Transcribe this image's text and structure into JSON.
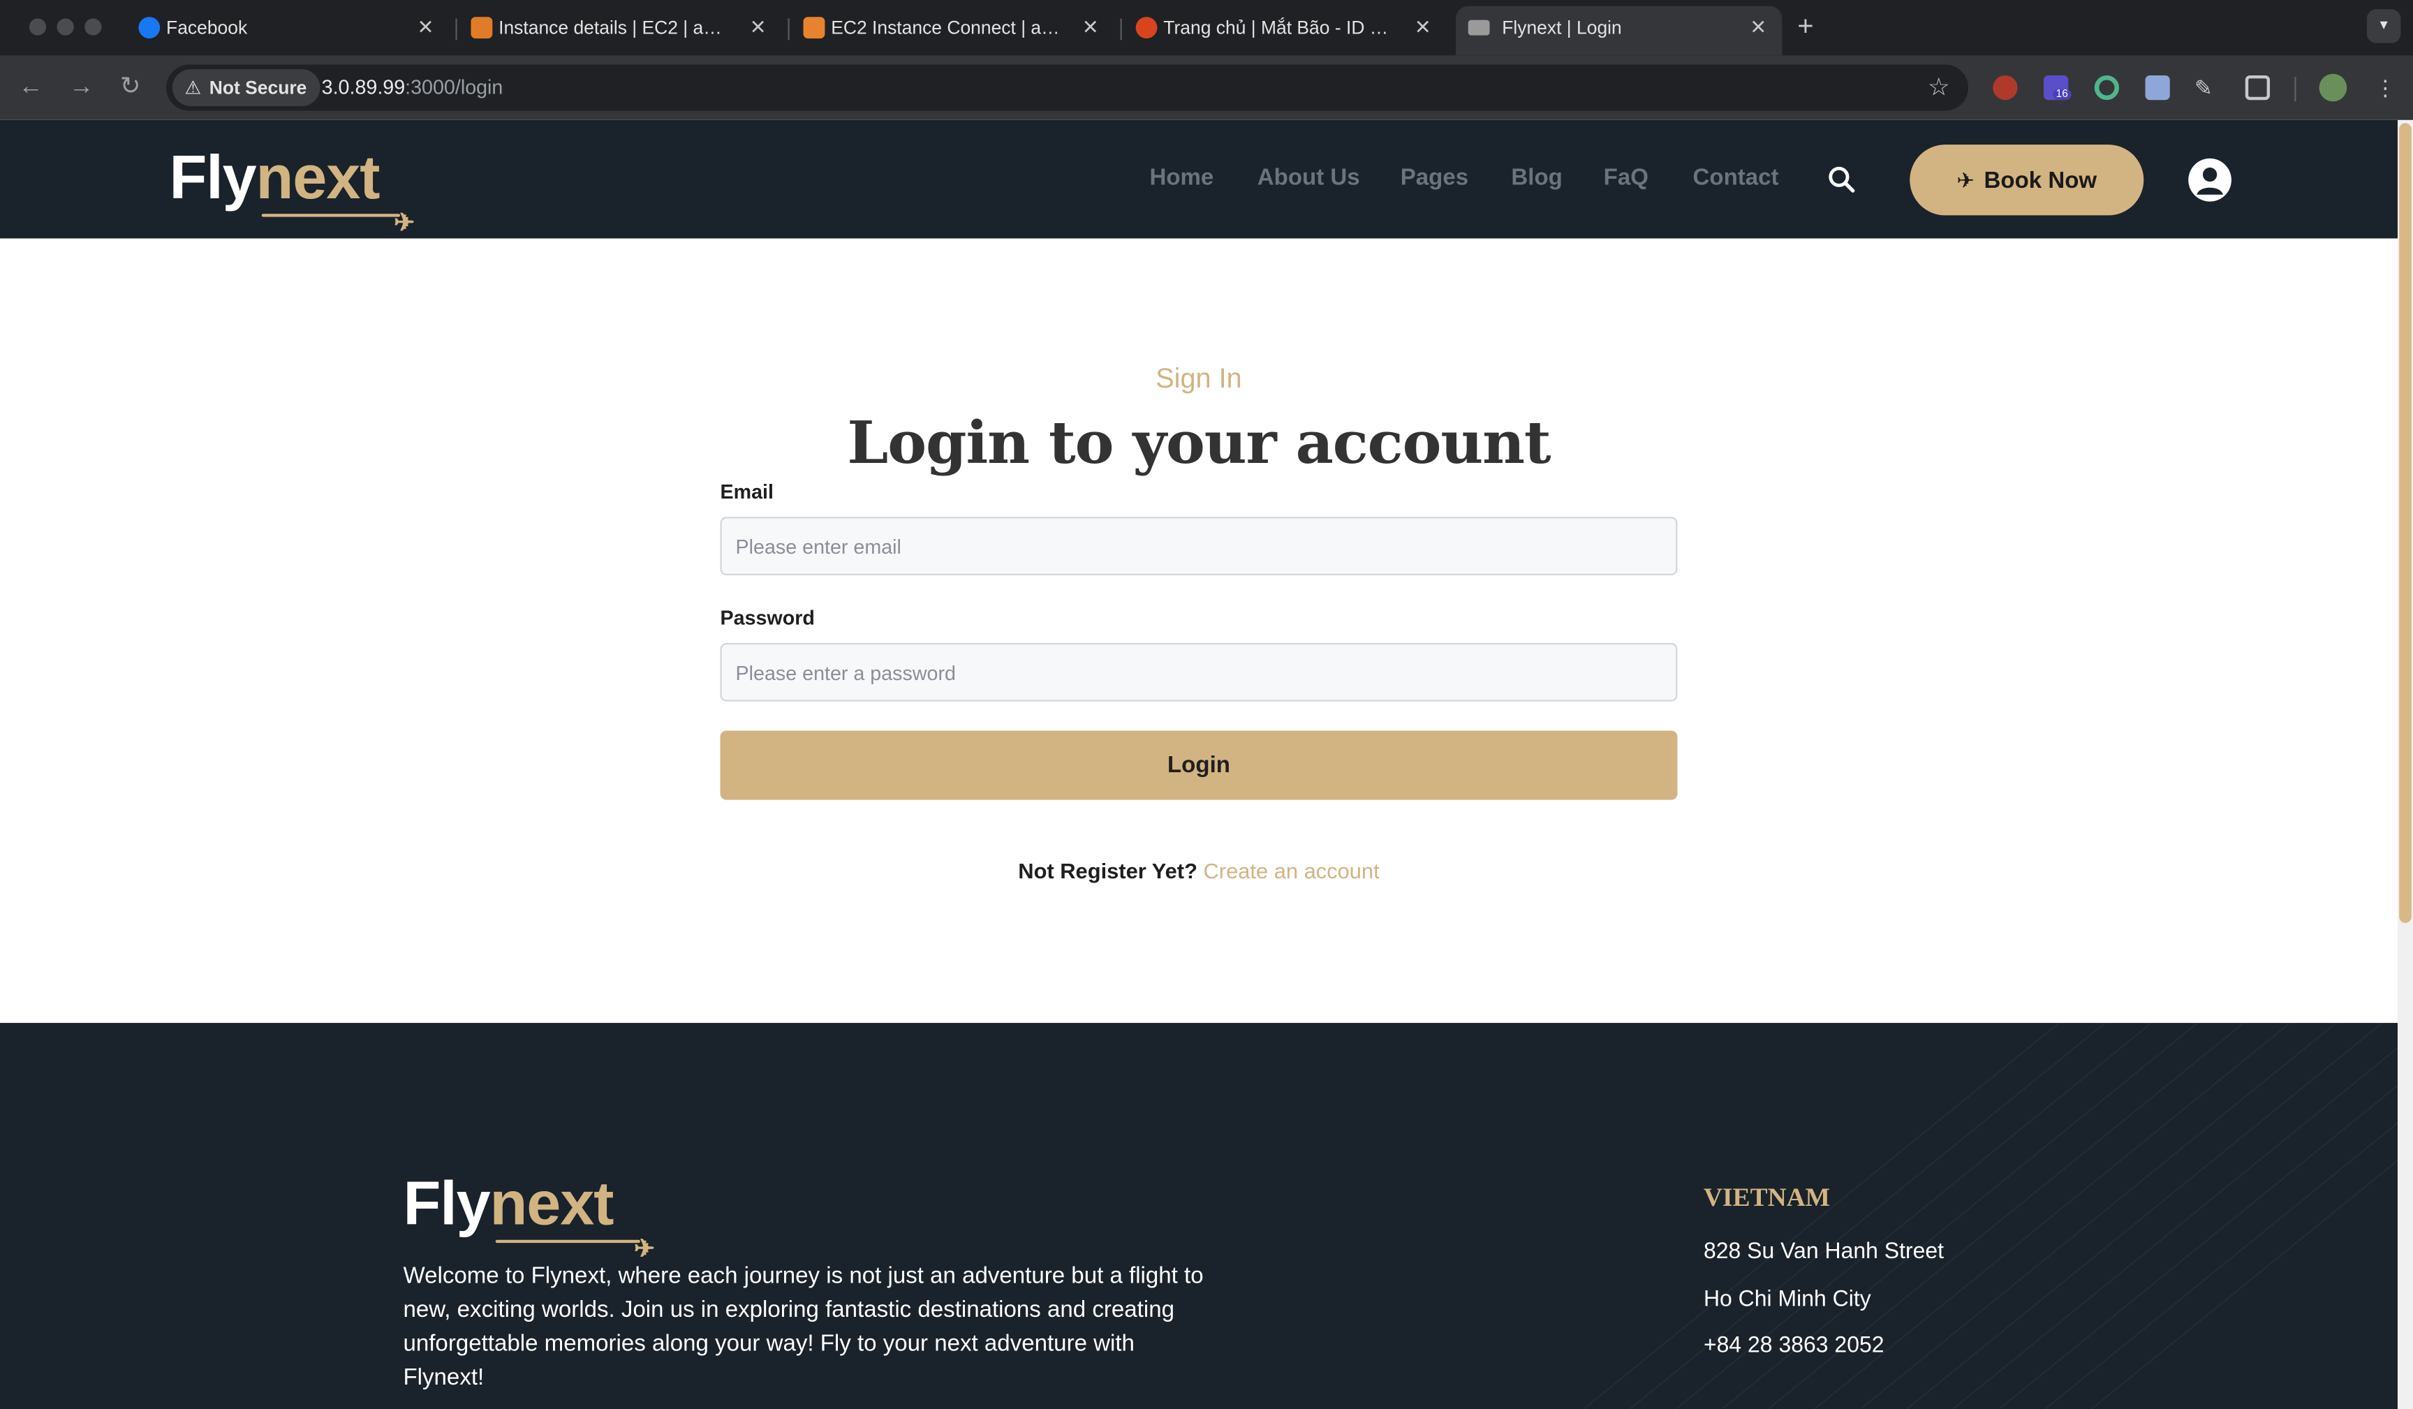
{
  "browser": {
    "tabs": [
      {
        "title": "Facebook",
        "color": "#1877f2"
      },
      {
        "title": "Instance details | EC2 | ap-southeast-1",
        "color": "#e07b28"
      },
      {
        "title": "EC2 Instance Connect | ap-southeast-1",
        "color": "#e8832d"
      },
      {
        "title": "Trang chủ | Mắt Bão - ID Portal",
        "color": "#d9441f"
      },
      {
        "title": "Flynext | Login",
        "color": "#888888"
      }
    ],
    "security_label": "Not Secure",
    "url_host": "3.0.89.99",
    "url_rest": ":3000/login",
    "extension_badge": "16"
  },
  "site": {
    "logo_fly": "Fly",
    "logo_next": "next",
    "nav": [
      "Home",
      "About Us",
      "Pages",
      "Blog",
      "FaQ",
      "Contact"
    ],
    "book_now": "Book Now",
    "accent": "#d2b482",
    "header_bg": "#1a222b"
  },
  "login": {
    "eyebrow": "Sign In",
    "title": "Login to your account",
    "email_label": "Email",
    "email_placeholder": "Please enter email",
    "password_label": "Password",
    "password_placeholder": "Please enter a password",
    "login_button": "Login",
    "register_prompt": "Not Register Yet?",
    "register_link": "Create an account"
  },
  "footer": {
    "description": "Welcome to Flynext, where each journey is not just an adventure but a flight to new, exciting worlds. Join us in exploring fantastic destinations and creating unforgettable memories along your way! Fly to your next adventure with Flynext!",
    "country": "VIETNAM",
    "address_line1": "828 Su Van Hanh Street",
    "address_line2": "Ho Chi Minh City",
    "phone": "+84 28 3863 2052"
  }
}
